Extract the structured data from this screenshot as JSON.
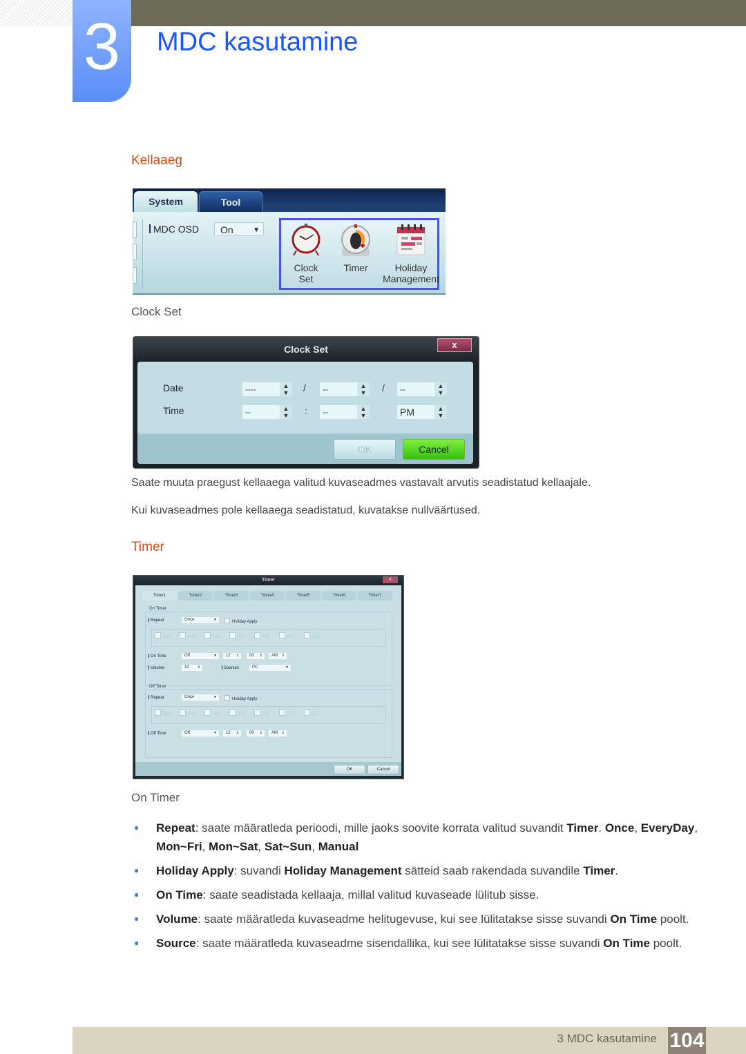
{
  "header": {
    "chapter_number": "3",
    "chapter_title": "MDC kasutamine"
  },
  "section_kellaaeg": {
    "title": "Kellaaeg",
    "toolbar": {
      "tabs": [
        {
          "label": "System",
          "active": true
        },
        {
          "label": "Tool",
          "active": false
        }
      ],
      "mdc_osd_label": "MDC OSD",
      "mdc_osd_value": "On",
      "icons": [
        {
          "name": "clock-icon",
          "label_line1": "Clock",
          "label_line2": "Set"
        },
        {
          "name": "timer-icon",
          "label_line1": "Timer",
          "label_line2": ""
        },
        {
          "name": "calendar-icon",
          "label_line1": "Holiday",
          "label_line2": "Management"
        }
      ],
      "highlight_color": "#4a4ef5"
    },
    "clock_set_heading": "Clock Set",
    "clock_dialog": {
      "title": "Clock Set",
      "close_label": "x",
      "date_label": "Date",
      "time_label": "Time",
      "date_year": "----",
      "date_month": "--",
      "date_day": "--",
      "date_separator": "/",
      "time_hour": "--",
      "time_minute": "--",
      "time_separator": ":",
      "time_ampm": "PM",
      "ok_label": "OK",
      "cancel_label": "Cancel"
    },
    "paragraphs": [
      "Saate muuta praegust kellaaega valitud kuvaseadmes vastavalt arvutis seadistatud kellaajale.",
      "Kui kuvaseadmes pole kellaaega seadistatud, kuvatakse nullväärtused."
    ]
  },
  "section_timer": {
    "title": "Timer",
    "dialog": {
      "title": "Timer",
      "close_label": "x",
      "tabs": [
        "Timer1",
        "Timer2",
        "Timer3",
        "Timer4",
        "Timer5",
        "Timer6",
        "Timer7"
      ],
      "on_timer": {
        "group_label": "On Timer",
        "repeat_label": "Repeat",
        "repeat_value": "Once",
        "holiday_apply_label": "Holiday Apply",
        "days": [
          "Sun",
          "Mon",
          "Tue",
          "Wed",
          "Thu",
          "Fri",
          "Sat"
        ],
        "on_time_label": "On Time",
        "on_time_value": "Off",
        "hour": "12",
        "minute": "00",
        "ampm": "AM",
        "volume_label": "Volume",
        "volume_value": "10",
        "sources_label": "Sources",
        "sources_value": "PC"
      },
      "off_timer": {
        "group_label": "Off Timer",
        "repeat_label": "Repeat",
        "repeat_value": "Once",
        "holiday_apply_label": "Holiday Apply",
        "days": [
          "Sun",
          "Mon",
          "Tue",
          "Wed",
          "Thu",
          "Fri",
          "Sat"
        ],
        "off_time_label": "Off Time",
        "off_time_value": "Off",
        "hour": "12",
        "minute": "00",
        "ampm": "AM"
      },
      "ok_label": "OK",
      "cancel_label": "Cancel"
    },
    "on_timer_heading": "On Timer",
    "bullets": [
      [
        {
          "b": "Repeat"
        },
        {
          "t": ": saate määratleda perioodi, mille jaoks soovite korrata valitud suvandit "
        },
        {
          "b": "Timer"
        },
        {
          "t": ". "
        },
        {
          "b": "Once"
        },
        {
          "t": ", "
        },
        {
          "b": "EveryDay"
        },
        {
          "t": ", "
        },
        {
          "b": "Mon~Fri"
        },
        {
          "t": ", "
        },
        {
          "b": "Mon~Sat"
        },
        {
          "t": ", "
        },
        {
          "b": "Sat~Sun"
        },
        {
          "t": ", "
        },
        {
          "b": "Manual"
        }
      ],
      [
        {
          "b": "Holiday Apply"
        },
        {
          "t": ": suvandi "
        },
        {
          "b": "Holiday Management"
        },
        {
          "t": " sätteid saab rakendada suvandile  "
        },
        {
          "b": "Timer"
        },
        {
          "t": "."
        }
      ],
      [
        {
          "b": "On Time"
        },
        {
          "t": ": saate seadistada kellaaja, millal valitud kuvaseade lülitub sisse."
        }
      ],
      [
        {
          "b": "Volume"
        },
        {
          "t": ": saate määratleda kuvaseadme helitugevuse, kui see lülitatakse sisse suvandi "
        },
        {
          "b": "On Time"
        },
        {
          "t": " poolt."
        }
      ],
      [
        {
          "b": "Source"
        },
        {
          "t": ": saate määratleda kuvaseadme sisendallika, kui see lülitatakse sisse suvandi "
        },
        {
          "b": "On Time"
        },
        {
          "t": " poolt."
        }
      ]
    ]
  },
  "footer": {
    "chapter_label": "3 MDC kasutamine",
    "page_number": "104"
  },
  "colors": {
    "chapter_blue": "#1a55ff",
    "heading_orange": "#d64b13",
    "bullet_blue": "#3b7ddd",
    "footer_bg": "#dbd4c0",
    "page_box": "#8e8175"
  }
}
